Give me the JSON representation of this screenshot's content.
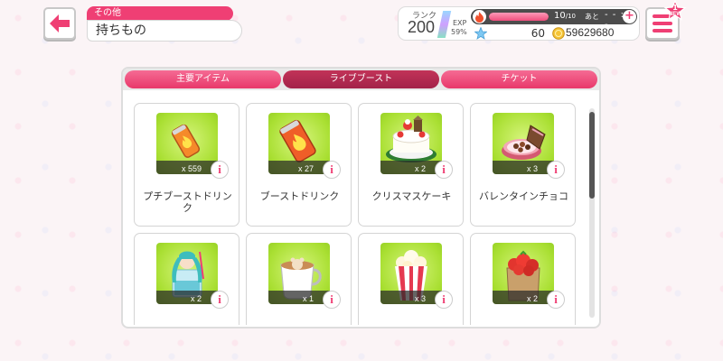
{
  "header": {
    "category": "その他",
    "title": "持ちもの"
  },
  "status": {
    "rank_label": "ランク",
    "rank": "200",
    "exp_label": "EXP",
    "exp_percent": "59%",
    "energy_current": "10",
    "energy_total": "/10",
    "energy_next_label": "あと",
    "energy_timer": "- - : - -",
    "energy_fraction": 1.0,
    "stars": "60",
    "coins": "59629680"
  },
  "badge": {
    "count": "1",
    "text": "NEW"
  },
  "tabs": [
    {
      "label": "主要アイテム",
      "active": false
    },
    {
      "label": "ライブブースト",
      "active": true
    },
    {
      "label": "チケット",
      "active": false
    }
  ],
  "items": [
    {
      "name": "プチブーストドリンク",
      "qty": "x 559",
      "icon": "small-drink-can-icon"
    },
    {
      "name": "ブーストドリンク",
      "qty": "x 27",
      "icon": "drink-can-icon"
    },
    {
      "name": "クリスマスケーキ",
      "qty": "x 2",
      "icon": "christmas-cake-icon"
    },
    {
      "name": "バレンタインチョコ",
      "qty": "x 3",
      "icon": "chocolate-box-icon"
    },
    {
      "name": "",
      "qty": "x 2",
      "icon": "miku-parfait-icon"
    },
    {
      "name": "",
      "qty": "x 1",
      "icon": "latte-cup-icon"
    },
    {
      "name": "",
      "qty": "x 3",
      "icon": "popcorn-icon"
    },
    {
      "name": "",
      "qty": "x 2",
      "icon": "strawberry-bag-icon"
    }
  ],
  "colors": {
    "accent": "#ef3f74",
    "item_bg": "#a9df32"
  }
}
